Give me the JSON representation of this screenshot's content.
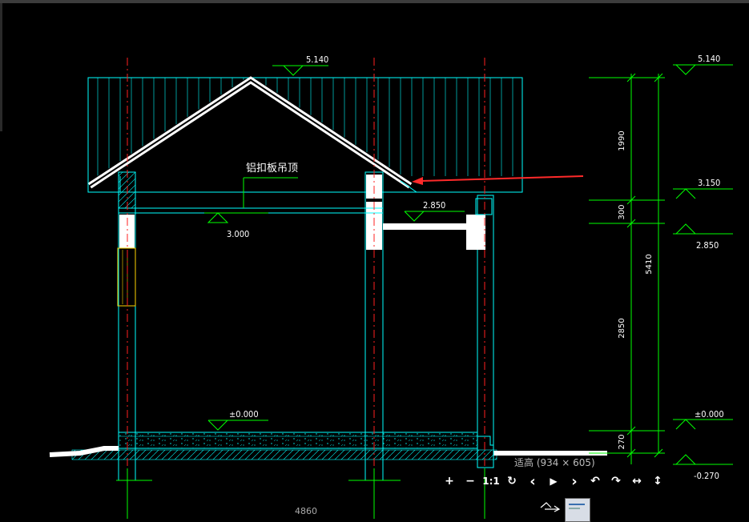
{
  "drawing": {
    "ridge_level": "5.140",
    "right_top_level": "5.140",
    "eave_level_right": "3.150",
    "floor_level_right": "2.850",
    "zero_level_right": "±0.000",
    "ground_level_right": "-0.270",
    "ceiling_note": "铝扣板吊顶",
    "ceiling_level": "3.000",
    "canopy_level": "2.850",
    "floor_level": "±0.000",
    "dim_1990": "1990",
    "dim_300": "300",
    "dim_2850": "2850",
    "dim_270": "270",
    "dim_5410": "5410",
    "bottom_dim": "4860"
  },
  "viewer": {
    "caption": "适高 (934 × 605)",
    "zoom_in": "+",
    "zoom_out": "−",
    "actual_size": "1:1",
    "rotate": "↻",
    "prev": "‹",
    "play": "▶",
    "next": "›",
    "rotate_left": "↶",
    "rotate_right": "↷",
    "fit_width": "↔",
    "fit_height": "↕"
  },
  "colors": {
    "outline": "#00ffff",
    "axis": "#ff2020",
    "dimension": "#00ff00",
    "arrow": "#ff2a2a",
    "fill": "#ffffff"
  }
}
